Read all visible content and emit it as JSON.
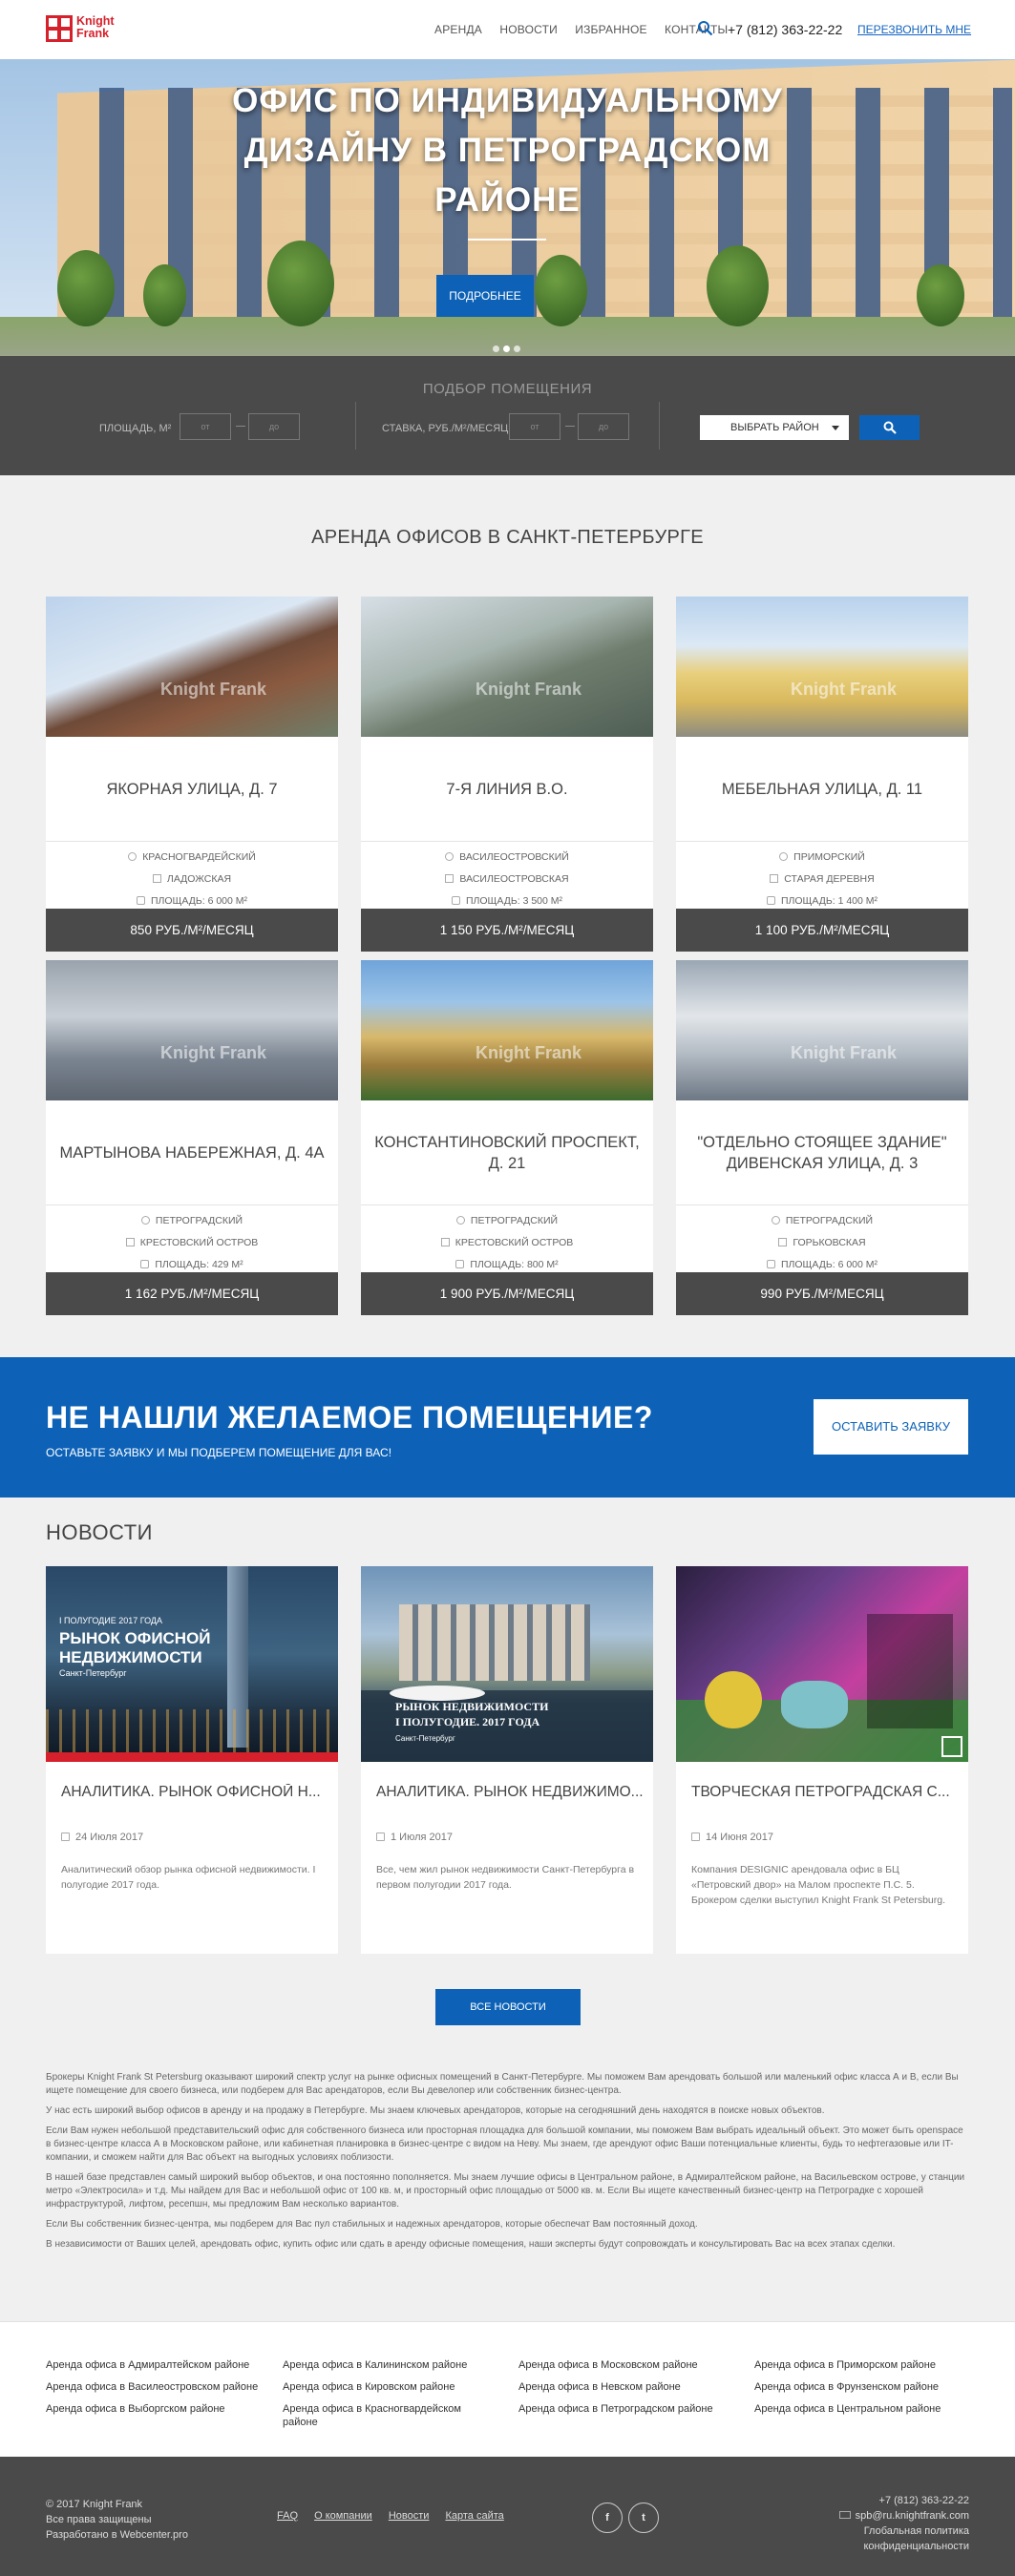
{
  "header": {
    "logo_line1": "Knight",
    "logo_line2": "Frank",
    "nav": [
      "АРЕНДА",
      "НОВОСТИ",
      "ИЗБРАННОЕ",
      "КОНТАКТЫ"
    ],
    "phone": "+7 (812) 363-22-22",
    "callback": "ПЕРЕЗВОНИТЬ МНЕ"
  },
  "hero": {
    "title": "ОФИС ПО ИНДИВИДУАЛЬНОМУ ДИЗАЙНУ В ПЕТРОГРАДСКОМ РАЙОНЕ",
    "button": "ПОДРОБНЕЕ"
  },
  "filter": {
    "title": "ПОДБОР ПОМЕЩЕНИЯ",
    "area_label": "ПЛОЩАДЬ, М²",
    "area_from": "от",
    "area_to": "до",
    "rate_label": "СТАВКА, РУБ./М²/МЕСЯЦ",
    "rate_from": "от",
    "rate_to": "до",
    "district_select": "ВЫБРАТЬ РАЙОН"
  },
  "offices_title": "АРЕНДА ОФИСОВ В САНКТ-ПЕТЕРБУРГЕ",
  "watermark": "Knight Frank",
  "offices": [
    {
      "name": "ЯКОРНАЯ УЛИЦА, Д. 7",
      "district": "КРАСНОГВАРДЕЙСКИЙ",
      "metro": "ЛАДОЖСКАЯ",
      "area": "ПЛОЩАДЬ: 6 000 М²",
      "price": "850 РУБ./М²/МЕСЯЦ"
    },
    {
      "name": "7-Я ЛИНИЯ В.О.",
      "district": "ВАСИЛЕОСТРОВСКИЙ",
      "metro": "ВАСИЛЕОСТРОВСКАЯ",
      "area": "ПЛОЩАДЬ: 3 500 М²",
      "price": "1 150 РУБ./М²/МЕСЯЦ"
    },
    {
      "name": "МЕБЕЛЬНАЯ УЛИЦА, Д. 11",
      "district": "ПРИМОРСКИЙ",
      "metro": "СТАРАЯ ДЕРЕВНЯ",
      "area": "ПЛОЩАДЬ: 1 400 М²",
      "price": "1 100 РУБ./М²/МЕСЯЦ"
    },
    {
      "name": "МАРТЫНОВА НАБЕРЕЖНАЯ, Д. 4А",
      "district": "ПЕТРОГРАДСКИЙ",
      "metro": "КРЕСТОВСКИЙ ОСТРОВ",
      "area": "ПЛОЩАДЬ: 429 М²",
      "price": "1 162 РУБ./М²/МЕСЯЦ"
    },
    {
      "name": "КОНСТАНТИНОВСКИЙ ПРОСПЕКТ, Д. 21",
      "district": "ПЕТРОГРАДСКИЙ",
      "metro": "КРЕСТОВСКИЙ ОСТРОВ",
      "area": "ПЛОЩАДЬ: 800 М²",
      "price": "1 900 РУБ./М²/МЕСЯЦ"
    },
    {
      "name": "\"ОТДЕЛЬНО СТОЯЩЕЕ ЗДАНИЕ\" ДИВЕНСКАЯ УЛИЦА, Д. 3",
      "district": "ПЕТРОГРАДСКИЙ",
      "metro": "ГОРЬКОВСКАЯ",
      "area": "ПЛОЩАДЬ: 6 000 М²",
      "price": "990 РУБ./М²/МЕСЯЦ"
    }
  ],
  "cta": {
    "heading": "НЕ НАШЛИ ЖЕЛАЕМОЕ ПОМЕЩЕНИЕ?",
    "subtext": "ОСТАВЬТЕ ЗАЯВКУ И МЫ ПОДБЕРЕМ ПОМЕЩЕНИЕ ДЛЯ ВАС!",
    "button": "ОСТАВИТЬ ЗАЯВКУ"
  },
  "news": {
    "title": "НОВОСТИ",
    "items": [
      {
        "img_line1": "I ПОЛУГОДИЕ 2017 ГОДА",
        "img_line2": "РЫНОК ОФИСНОЙ",
        "img_line3": "НЕДВИЖИМОСТИ",
        "img_line4": "Санкт-Петербург",
        "title": "АНАЛИТИКА. РЫНОК ОФИСНОЙ Н...",
        "date": "24 Июля 2017",
        "excerpt": "Аналитический обзор рынка офисной недвижимости. I полугодие 2017 года."
      },
      {
        "img_line1": "РЫНОК НЕДВИЖИМОСТИ",
        "img_line2": "I ПОЛУГОДИЕ. 2017 ГОДА",
        "img_line3": "Санкт-Петербург",
        "title": "АНАЛИТИКА. РЫНОК НЕДВИЖИМО...",
        "date": "1 Июля 2017",
        "excerpt": "Все, чем жил рынок недвижимости Санкт-Петербурга в первом полугодии 2017 года."
      },
      {
        "title": "ТВОРЧЕСКАЯ ПЕТРОГРАДСКАЯ С...",
        "date": "14 Июня 2017",
        "excerpt": "Компания DESIGNIC арендовала офис в БЦ «Петровский двор» на Малом проспекте П.С. 5. Брокером сделки выступил Knight Frank St Petersburg."
      }
    ],
    "all_button": "ВСЕ НОВОСТИ"
  },
  "seo_text": [
    "Брокеры Knight Frank St Petersburg оказывают широкий спектр услуг на рынке офисных помещений в Санкт-Петербурге. Мы поможем Вам арендовать большой или маленький офис класса А и В, если Вы ищете помещение для своего бизнеса, или подберем для Вас арендаторов, если Вы девелопер или собственник бизнес-центра.",
    "У нас есть широкий выбор офисов в аренду и на продажу в Петербурге. Мы знаем ключевых арендаторов, которые на сегодняшний день находятся в поиске новых объектов.",
    "Если Вам нужен небольшой представительский офис для собственного бизнеса или просторная площадка для большой компании, мы поможем Вам выбрать идеальный объект. Это может быть openspace в бизнес-центре класса А в Московском районе, или кабинетная планировка в бизнес-центре с видом на Неву. Мы знаем, где арендуют офис Ваши потенциальные клиенты, будь то нефтегазовые или IT-компании, и сможем найти для Вас объект на выгодных условиях поблизости.",
    "В нашей базе представлен самый широкий выбор объектов, и она постоянно пополняется. Мы знаем лучшие офисы в Центральном районе, в Адмиралтейском районе, на Васильевском острове, у станции метро «Электросила» и т.д. Мы найдем для Вас и небольшой офис от 100 кв. м, и просторный офис площадью от 5000 кв. м. Если Вы ищете качественный бизнес-центр на Петроградке с хорошей инфраструктурой, лифтом, ресепшн, мы предложим Вам несколько вариантов.",
    "Если Вы собственник бизнес-центра, мы подберем для Вас пул стабильных и надежных арендаторов, которые обеспечат Вам постоянный доход.",
    "В независимости от Ваших целей, арендовать офис, купить офис или сдать в аренду офисные помещения, наши эксперты будут сопровождать и консультировать Вас на всех этапах сделки."
  ],
  "district_links": [
    [
      "Аренда офиса в Адмиралтейском районе",
      "Аренда офиса в Василеостровском районе",
      "Аренда офиса в Выборгском районе"
    ],
    [
      "Аренда офиса в Калининском районе",
      "Аренда офиса в Кировском районе",
      "Аренда офиса в Красногвардейском районе"
    ],
    [
      "Аренда офиса в Московском районе",
      "Аренда офиса в Невском районе",
      "Аренда офиса в Петроградском районе"
    ],
    [
      "Аренда офиса в Приморском районе",
      "Аренда офиса в Фрунзенском районе",
      "Аренда офиса в Центральном районе"
    ]
  ],
  "footer": {
    "copyright": "© 2017 Knight Frank",
    "rights": "Все права защищены",
    "dev": "Разработано в Webcenter.pro",
    "links": [
      "FAQ",
      "О компании",
      "Новости",
      "Карта сайта"
    ],
    "social": [
      "f",
      "t"
    ],
    "phone": "+7 (812) 363-22-22",
    "email": "spb@ru.knightfrank.com",
    "policy_line1": "Глобальная политика",
    "policy_line2": "конфиденциальности"
  }
}
